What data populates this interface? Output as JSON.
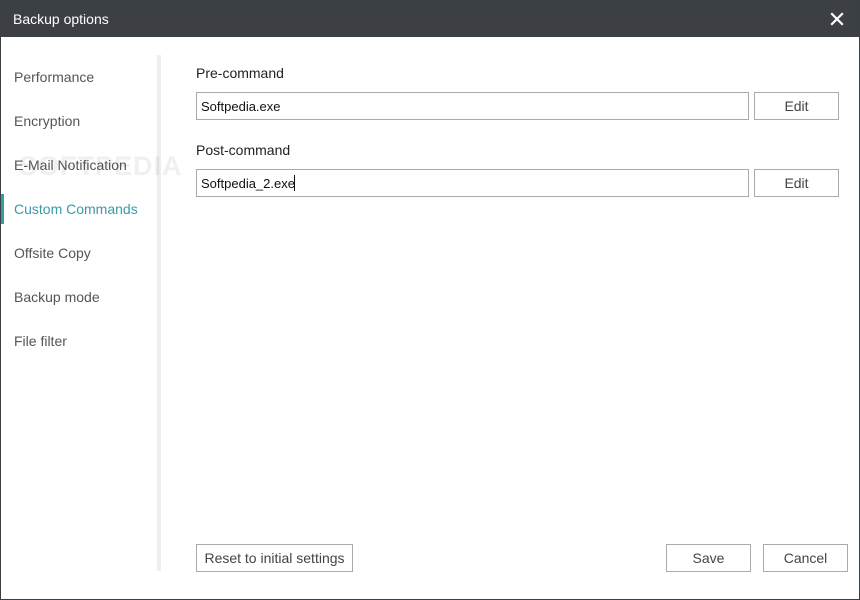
{
  "window": {
    "title": "Backup options"
  },
  "sidebar": {
    "items": [
      {
        "label": "Performance"
      },
      {
        "label": "Encryption"
      },
      {
        "label": "E-Mail Notification"
      },
      {
        "label": "Custom Commands"
      },
      {
        "label": "Offsite Copy"
      },
      {
        "label": "Backup mode"
      },
      {
        "label": "File filter"
      }
    ],
    "active": "Custom Commands",
    "watermark": "SOFTPEDIA"
  },
  "main": {
    "pre_command": {
      "label": "Pre-command",
      "value": "Softpedia.exe",
      "edit_label": "Edit"
    },
    "post_command": {
      "label": "Post-command",
      "value": "Softpedia_2.exe",
      "edit_label": "Edit"
    }
  },
  "footer": {
    "reset_label": "Reset to initial settings",
    "save_label": "Save",
    "cancel_label": "Cancel"
  },
  "colors": {
    "titlebar": "#3c4044",
    "accent": "#3a9aa8"
  },
  "icons": {
    "close": "close-icon"
  }
}
